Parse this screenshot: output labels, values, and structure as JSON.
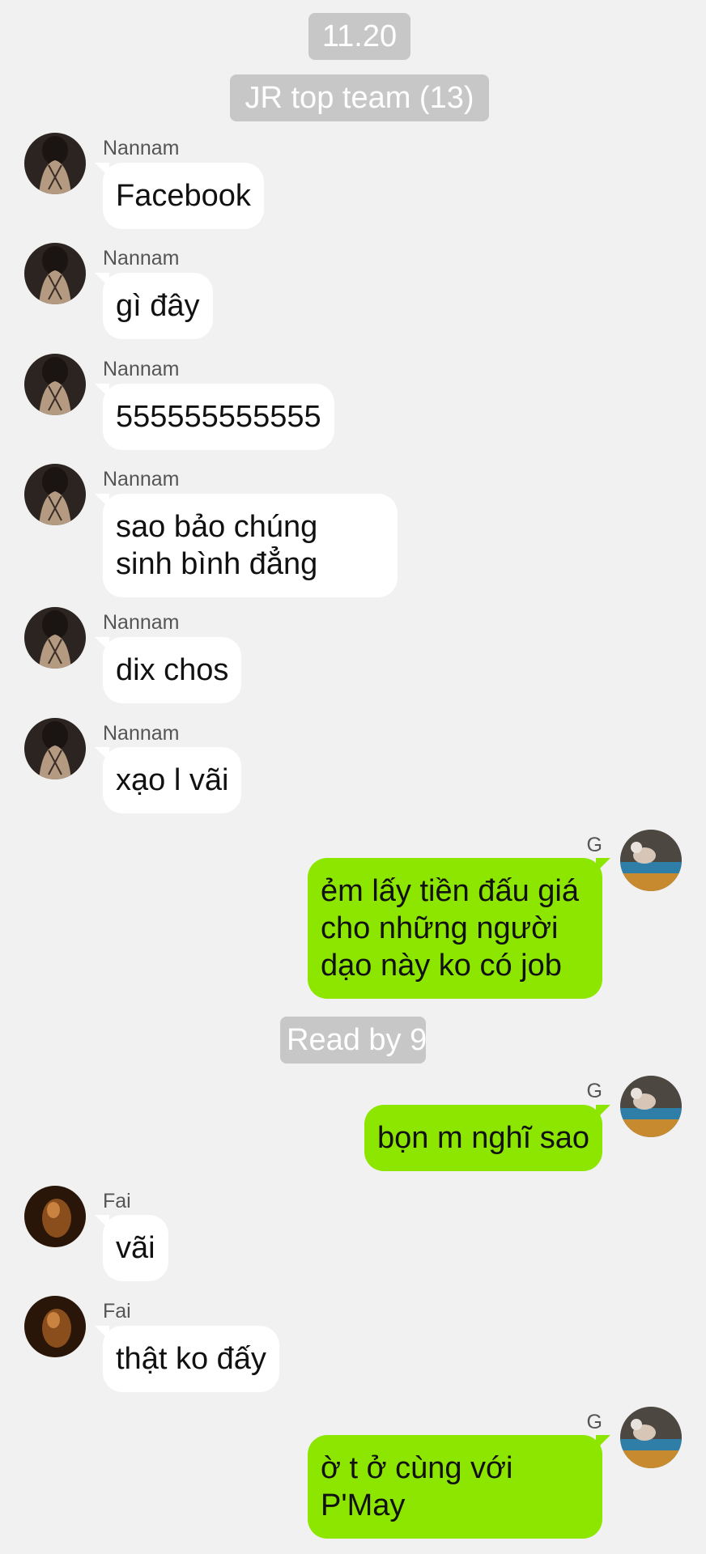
{
  "date_label": "11.20",
  "group_title": "JR top team (13)",
  "read_receipt": "Read by 9",
  "messages": [
    {
      "sender": "Nannam",
      "text": "Facebook"
    },
    {
      "sender": "Nannam",
      "text": "gì đây"
    },
    {
      "sender": "Nannam",
      "text": "555555555555"
    },
    {
      "sender": "Nannam",
      "text": "sao bảo chúng\nsinh bình đẳng"
    },
    {
      "sender": "Nannam",
      "text": "dix chos"
    },
    {
      "sender": "Nannam",
      "text": "xạo l vãi"
    },
    {
      "sender": "G",
      "text": "ẻm lấy tiền đấu giá\ncho những người\ndạo này ko có job"
    },
    {
      "sender": "G",
      "text": "bọn m nghĩ sao"
    },
    {
      "sender": "Fai",
      "text": "vãi"
    },
    {
      "sender": "Fai",
      "text": "thật ko đấy"
    },
    {
      "sender": "G",
      "text": "ờ t ở cùng với\nP'May"
    }
  ],
  "colors": {
    "background": "#f2f1f2",
    "pill": "#c7c7c7",
    "incoming_bubble": "#ffffff",
    "outgoing_bubble": "#8ce600"
  },
  "icons": {
    "nannam_avatar": "avatar-photo",
    "g_avatar": "avatar-photo",
    "fai_avatar": "avatar-photo"
  }
}
